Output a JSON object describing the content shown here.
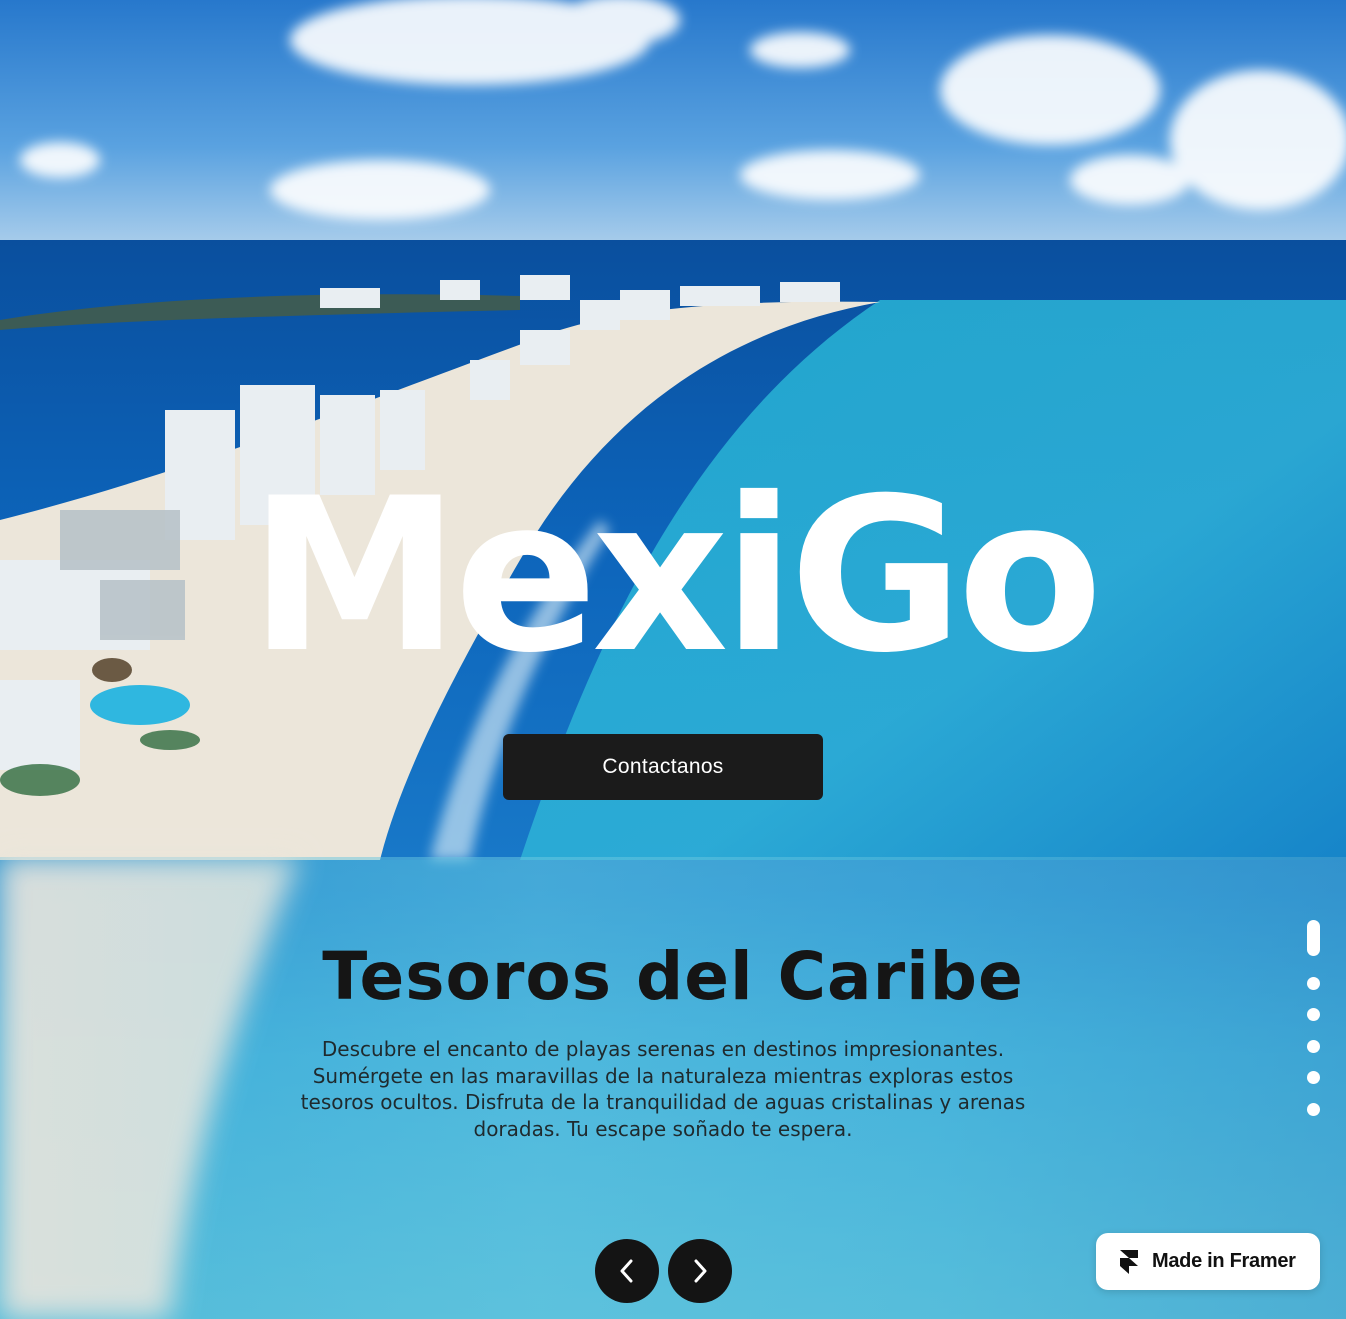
{
  "hero": {
    "title": "MexiGo",
    "cta_label": "Contactanos"
  },
  "slide": {
    "title": "Tesoros del Caribe",
    "description": "Descubre el encanto de playas serenas en destinos impresionantes. Sumérgete en las maravillas de la naturaleza mientras exploras estos tesoros ocultos. Disfruta de la tranquilidad de aguas cristalinas y arenas doradas. Tu escape soñado te espera.",
    "prev_icon": "chevron-left-icon",
    "next_icon": "chevron-right-icon"
  },
  "pagination": {
    "total": 6,
    "active_index": 0
  },
  "badge": {
    "label": "Made in Framer",
    "icon": "framer-logo-icon"
  },
  "colors": {
    "button_dark": "#1b1b1b",
    "text_light": "#ffffff",
    "heading_dark": "#151515"
  }
}
